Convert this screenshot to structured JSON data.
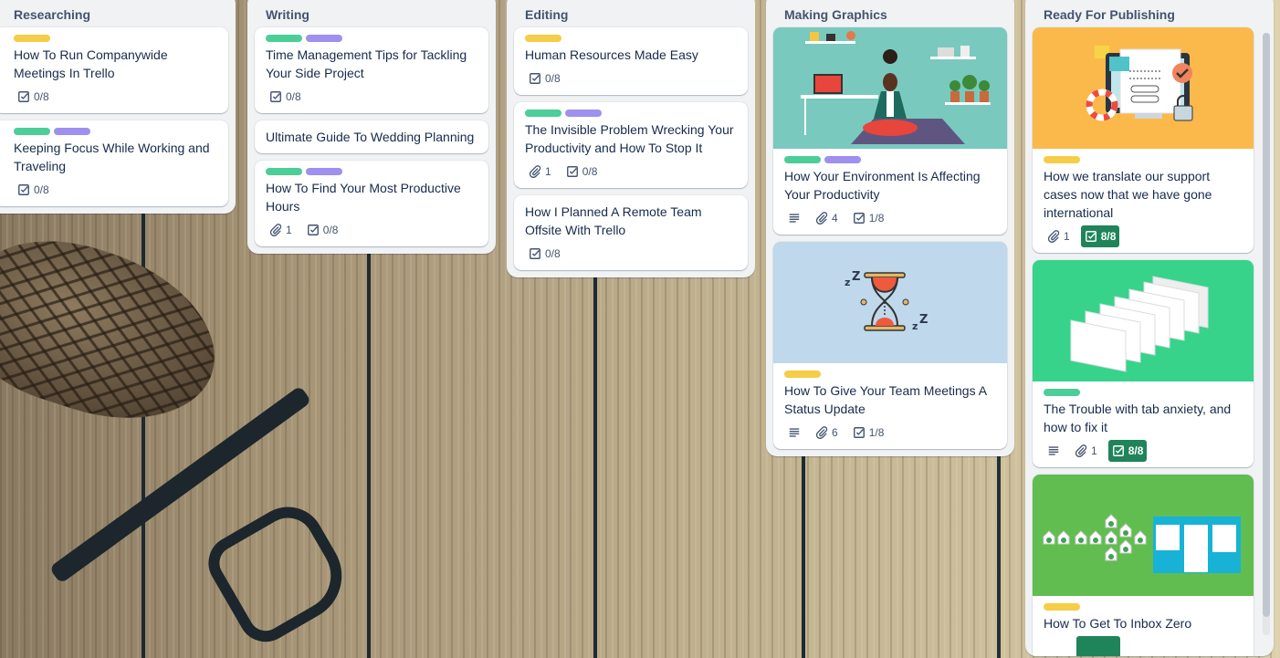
{
  "colors": {
    "label_yellow": "#f5cd47",
    "label_green": "#4bce97",
    "label_purple": "#9f8fef",
    "complete_badge": "#1f845a"
  },
  "lists": [
    {
      "title": "Researching",
      "cards": [
        {
          "labels": [
            "yellow"
          ],
          "title": "How To Run Companywide Meetings In Trello",
          "checklist": "0/8"
        },
        {
          "labels": [
            "green",
            "purple"
          ],
          "title": "Keeping Focus While Working and Traveling",
          "checklist": "0/8"
        }
      ]
    },
    {
      "title": "Writing",
      "cards": [
        {
          "labels": [
            "green",
            "purple"
          ],
          "title": "Time Management Tips for Tackling Your Side Project",
          "checklist": "0/8"
        },
        {
          "labels": [],
          "title": "Ultimate Guide To Wedding Planning"
        },
        {
          "labels": [
            "green",
            "purple"
          ],
          "title": "How To Find Your Most Productive Hours",
          "attachments": "1",
          "checklist": "0/8"
        }
      ]
    },
    {
      "title": "Editing",
      "cards": [
        {
          "labels": [
            "yellow"
          ],
          "title": "Human Resources Made Easy",
          "checklist": "0/8"
        },
        {
          "labels": [
            "green",
            "purple"
          ],
          "title": "The Invisible Problem Wrecking Your Productivity and How To Stop It",
          "attachments": "1",
          "checklist": "0/8"
        },
        {
          "labels": [],
          "title": "How I Planned A Remote Team Offsite With Trello",
          "checklist": "0/8"
        }
      ]
    },
    {
      "title": "Making Graphics",
      "cards": [
        {
          "cover": "meditation-illustration",
          "labels": [
            "green",
            "purple"
          ],
          "title": "How Your Environment Is Affecting Your Productivity",
          "description": true,
          "attachments": "4",
          "checklist": "1/8"
        },
        {
          "cover": "hourglass-illustration",
          "labels": [
            "yellow"
          ],
          "title": "How To Give Your Team Meetings A Status Update",
          "description": true,
          "attachments": "6",
          "checklist": "1/8"
        }
      ]
    },
    {
      "title": "Ready For Publishing",
      "cards": [
        {
          "cover": "support-translate-illustration",
          "labels": [
            "yellow"
          ],
          "title": "How we translate our support cases now that we have gone international",
          "attachments": "1",
          "checklist": "8/8",
          "checklist_complete": true
        },
        {
          "cover": "browser-tabs-illustration",
          "labels": [
            "green"
          ],
          "title": "The Trouble with tab anxiety, and how to fix it",
          "description": true,
          "attachments": "1",
          "checklist": "8/8",
          "checklist_complete": true
        },
        {
          "cover": "inbox-zero-illustration",
          "labels": [
            "yellow"
          ],
          "title": "How To Get To Inbox Zero",
          "checklist_complete": true
        }
      ]
    }
  ]
}
